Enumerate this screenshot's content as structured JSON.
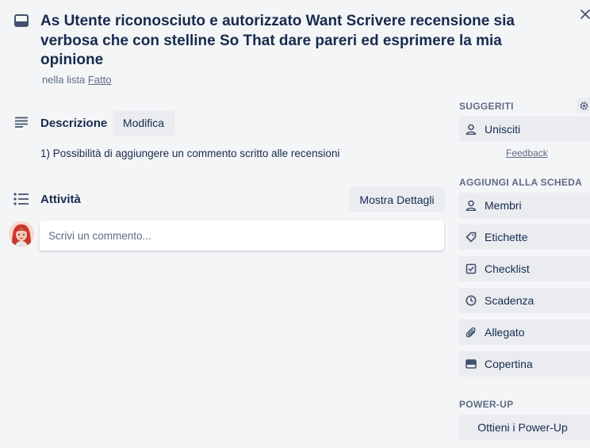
{
  "card": {
    "title": "As Utente riconosciuto e autorizzato Want Scrivere recensione sia verbosa che con stelline So That dare pareri ed esprimere la mia opinione",
    "list_prefix": "nella lista",
    "list_name": "Fatto"
  },
  "description": {
    "heading": "Descrizione",
    "edit_label": "Modifica",
    "text": "1) Possibilità di aggiungere un commento scritto alle recensioni"
  },
  "activity": {
    "heading": "Attività",
    "details_label": "Mostra Dettagli",
    "comment_placeholder": "Scrivi un commento..."
  },
  "sidebar": {
    "suggested_heading": "SUGGERITI",
    "join_label": "Unisciti",
    "feedback_label": "Feedback",
    "add_heading": "AGGIUNGI ALLA SCHEDA",
    "add_items": [
      {
        "label": "Membri",
        "icon": "person-icon"
      },
      {
        "label": "Etichette",
        "icon": "tag-icon"
      },
      {
        "label": "Checklist",
        "icon": "checkbox-icon"
      },
      {
        "label": "Scadenza",
        "icon": "clock-icon"
      },
      {
        "label": "Allegato",
        "icon": "paperclip-icon"
      },
      {
        "label": "Copertina",
        "icon": "card-cover-icon"
      }
    ],
    "powerup_heading": "POWER-UP",
    "powerup_label": "Ottieni i Power-Up"
  },
  "colors": {
    "background": "#f4f5f7",
    "text": "#172b4d",
    "muted": "#5e6c84",
    "button": "#eaecf0"
  }
}
